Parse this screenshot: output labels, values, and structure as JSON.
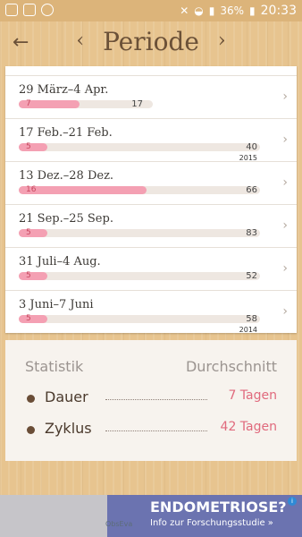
{
  "statusbar": {
    "left_icons": [
      "skype-icon",
      "image-icon",
      "circle-icon"
    ],
    "right_icons": [
      "mute-icon",
      "wifi-icon",
      "signal-icon",
      "battery-icon"
    ],
    "battery": "36%",
    "time": "20:33"
  },
  "header": {
    "title": "Periode",
    "back_icon": "arrow-left-icon",
    "prev_icon": "chevron-left-icon",
    "next_icon": "chevron-right-icon"
  },
  "periods": [
    {
      "range": "29 März–4 Apr.",
      "duration": "7",
      "cycle": "17",
      "fill_fraction": 0.25,
      "year": ""
    },
    {
      "range": "17 Feb.–21 Feb.",
      "duration": "5",
      "cycle": "40",
      "fill_fraction": 0.12,
      "year": "2015"
    },
    {
      "range": "13 Dez.–28 Dez.",
      "duration": "16",
      "cycle": "66",
      "fill_fraction": 0.53,
      "year": ""
    },
    {
      "range": "21 Sep.–25 Sep.",
      "duration": "5",
      "cycle": "83",
      "fill_fraction": 0.12,
      "year": ""
    },
    {
      "range": "31 Juli–4 Aug.",
      "duration": "5",
      "cycle": "52",
      "fill_fraction": 0.12,
      "year": ""
    },
    {
      "range": "3 Juni–7 Juni",
      "duration": "5",
      "cycle": "58",
      "fill_fraction": 0.12,
      "year": "2014"
    }
  ],
  "stats": {
    "header_left": "Statistik",
    "header_right": "Durchschnitt",
    "rows": [
      {
        "label": "Dauer",
        "value": "7 Tagen"
      },
      {
        "label": "Zyklus",
        "value": "42 Tagen"
      }
    ]
  },
  "ad": {
    "title": "ENDOMETRIOSE?",
    "subtitle": "Info zur Forschungsstudie »",
    "logo": "ObsEva",
    "info_icon": "info-icon"
  },
  "colors": {
    "accent_pink": "#f4a0b3",
    "value_pink": "#e06a7d",
    "wood": "#e7c48f",
    "header_brown": "#6b5138"
  }
}
